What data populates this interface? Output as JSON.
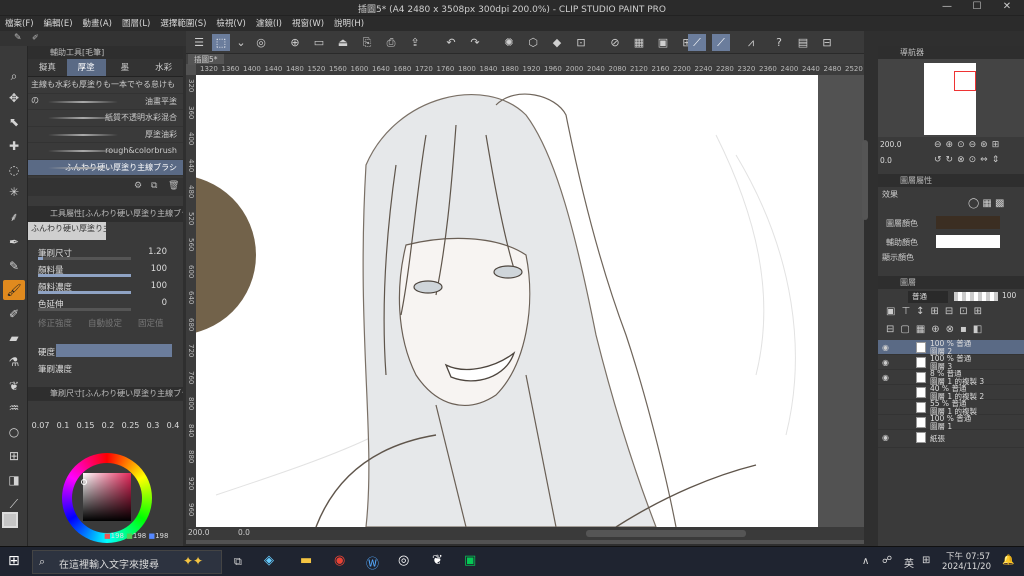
{
  "window": {
    "title": "插圖5* (A4 2480 x 3508px 300dpi 200.0%) - CLIP STUDIO PAINT PRO",
    "controls": [
      "—",
      "☐",
      "✕"
    ]
  },
  "menu": [
    "檔案(F)",
    "編輯(E)",
    "動畫(A)",
    "圖層(L)",
    "選擇範圍(S)",
    "檢視(V)",
    "濾鏡(I)",
    "視窗(W)",
    "說明(H)"
  ],
  "canvas_tab": "插圖5*",
  "subtool": {
    "header": "輔助工具[毛筆]",
    "tabs": [
      "擬真",
      "厚塗",
      "墨",
      "水彩"
    ],
    "active_tab": 1,
    "brushes": [
      "主線も水彩も厚塗りも一本でやる怠けもの",
      "油畫平塗",
      "紙質不透明水彩混合",
      "厚塗油彩",
      "rough&colorbrush",
      "ふんわり硬い厚塗り主線ブラシ"
    ],
    "active_brush": 5
  },
  "tool_property": {
    "header": "工具屬性[ふんわり硬い厚塗り主線ブラシ]",
    "brush_name": "ふんわり硬い厚塗り主線ブラシ",
    "rows": [
      {
        "label": "筆刷尺寸",
        "value": "1.20",
        "fill": 0.05
      },
      {
        "label": "顏料量",
        "value": "100",
        "fill": 1.0
      },
      {
        "label": "顏料濃度",
        "value": "100",
        "fill": 1.0
      },
      {
        "label": "色延伸",
        "value": "0",
        "fill": 0.0
      }
    ],
    "disabled_row": [
      "修正強度",
      "自動設定",
      "固定值"
    ],
    "hardness_label": "硬度",
    "density_label": "筆刷濃度"
  },
  "brush_size": {
    "header": "筆刷尺寸[ふんわり硬い厚塗り主線ブラシ]",
    "presets": [
      "0.07",
      "0.1",
      "0.15",
      "0.2",
      "0.25",
      "0.3",
      "0.4"
    ]
  },
  "color": {
    "main": "#3b2e22",
    "sub": "#ffffff",
    "rgb": [
      "198",
      "198",
      "198"
    ]
  },
  "ruler_labels": [
    "1320",
    "1360",
    "1400",
    "1440",
    "1480",
    "1520",
    "1560",
    "1600",
    "1640",
    "1680",
    "1720",
    "1760",
    "1800",
    "1840",
    "1880",
    "1920",
    "1960",
    "2000",
    "2040",
    "2080",
    "2120",
    "2160",
    "2200",
    "2240",
    "2280",
    "2320",
    "2360",
    "2400",
    "2440",
    "2480",
    "2520"
  ],
  "ruler_v_labels": [
    "320",
    "360",
    "400",
    "440",
    "480",
    "520",
    "560",
    "600",
    "640",
    "680",
    "720",
    "760",
    "800",
    "840",
    "880",
    "920",
    "960"
  ],
  "status": {
    "zoom": "200.0",
    "rotate": "0.0"
  },
  "navigator": {
    "header": "導航器",
    "zoom": "200.0",
    "angle": "0.0"
  },
  "layer_property": {
    "header": "圖層屬性",
    "effect_label": "效果",
    "layer_color_label": "圖層顏色",
    "sub_color_label": "輔助顏色",
    "display_color_label": "顯示顏色"
  },
  "layers_panel": {
    "header": "圖層",
    "blend_mode": "普通",
    "opacity": "100",
    "layers": [
      {
        "line1": "100 % 普通",
        "line2": "圖層 2",
        "selected": true
      },
      {
        "line1": "100 % 普通",
        "line2": "圖層 3",
        "selected": false
      },
      {
        "line1": "8 % 普通",
        "line2": "圖層 1 的複製 3",
        "selected": false
      },
      {
        "line1": "40 % 普通",
        "line2": "圖層 1 的複製 2",
        "selected": false
      },
      {
        "line1": "55 % 普通",
        "line2": "圖層 1 的複製",
        "selected": false
      },
      {
        "line1": "100 % 普通",
        "line2": "圖層 1",
        "selected": false
      },
      {
        "line1": "紙張",
        "line2": "",
        "selected": false
      }
    ]
  },
  "taskbar": {
    "search_placeholder": "在這裡輸入文字來搜尋",
    "ime": "英",
    "time": "下午 07:57",
    "date": "2024/11/20"
  }
}
